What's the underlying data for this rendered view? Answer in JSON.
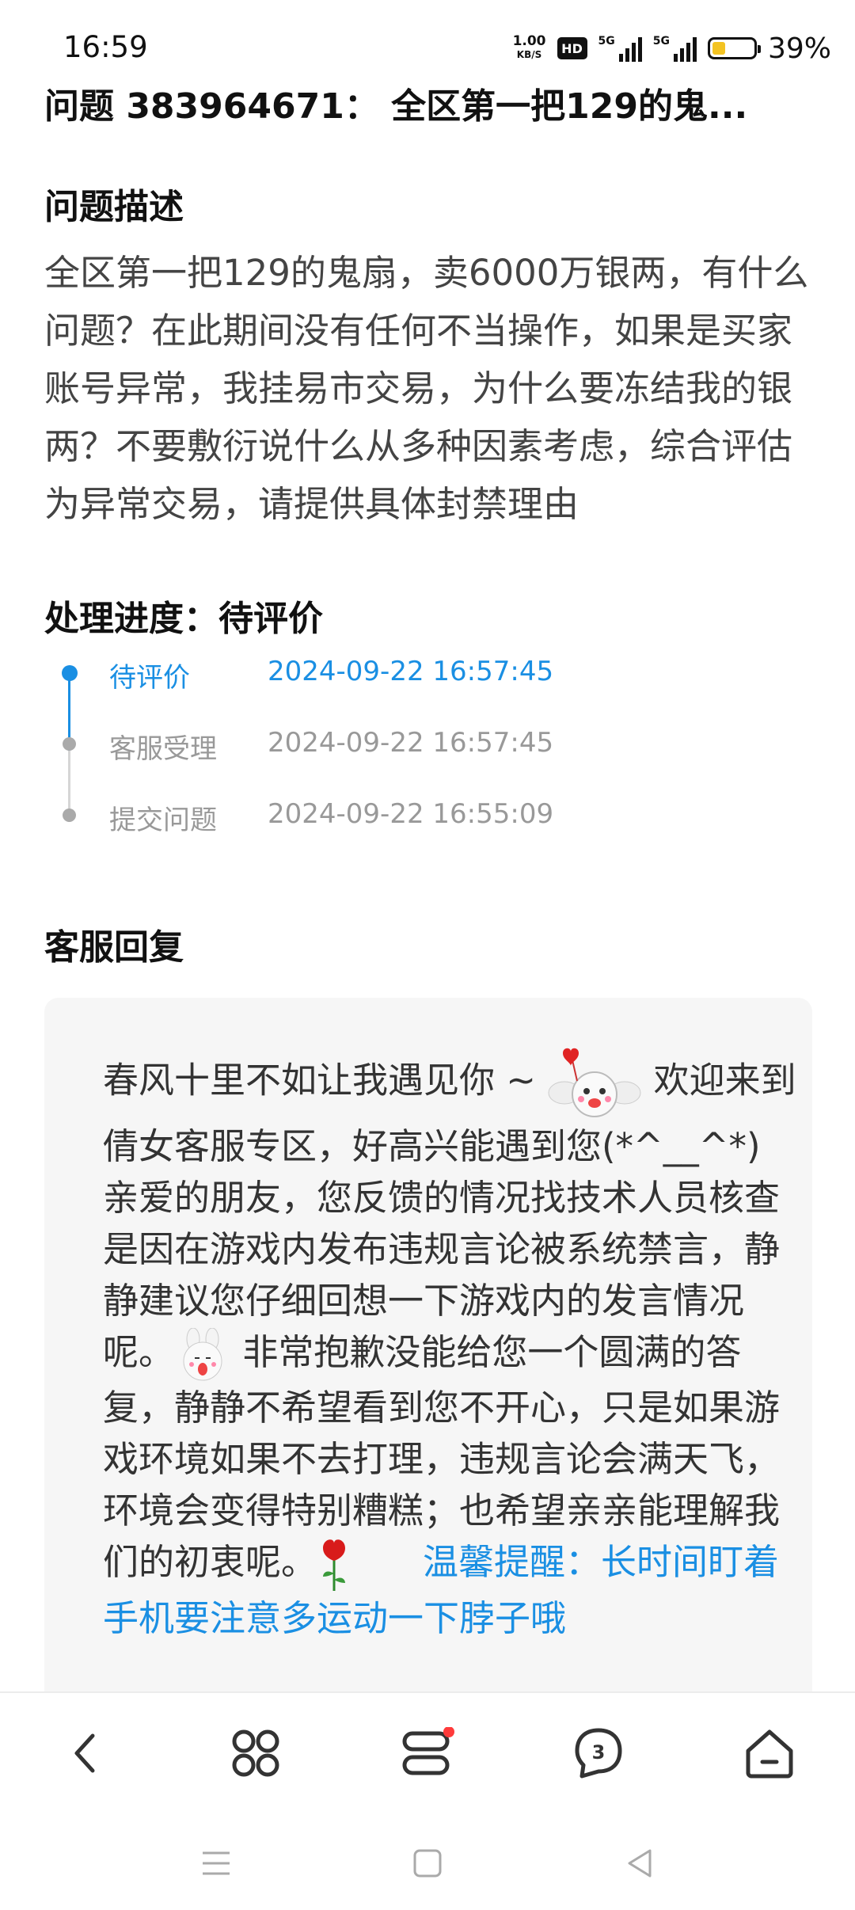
{
  "status_bar": {
    "time": "16:59",
    "net_speed_value": "1.00",
    "net_speed_unit": "KB/S",
    "hd_badge": "HD",
    "sim1": "5G",
    "sim2": "5G",
    "battery_level": 0.39,
    "battery_percent": "39%",
    "battery_color": "#f3c322"
  },
  "header": {
    "title": "问题 383964671：  全区第一把129的鬼..."
  },
  "description": {
    "heading": "问题描述",
    "text": "全区第一把129的鬼扇，卖6000万银两，有什么问题？在此期间没有任何不当操作，如果是买家账号异常，我挂易市交易，为什么要冻结我的银两？不要敷衍说什么从多种因素考虑，综合评估为异常交易，请提供具体封禁理由"
  },
  "progress": {
    "heading": "处理进度：待评价",
    "accent_color": "#1a8fe3",
    "steps": [
      {
        "label": "待评价",
        "time": "2024-09-22 16:57:45",
        "active": true
      },
      {
        "label": "客服受理",
        "time": "2024-09-22 16:57:45",
        "active": false
      },
      {
        "label": "提交问题",
        "time": "2024-09-22 16:55:09",
        "active": false
      }
    ]
  },
  "reply": {
    "heading": "客服回复",
    "part1": "春风十里不如让我遇见你 ~ ",
    "emoji1": "angel-heart-emoji",
    "part2": " 欢迎来到倩女客服专区，好高兴能遇到您(*^__^*)　　亲爱的朋友，您反馈的情况找技术人员核查是因在游戏内发布违规言论被系统禁言，静静建议您仔细回想一下游戏内的发言情况呢。",
    "emoji2": "crying-bunny-emoji",
    "part3": " 非常抱歉没能给您一个圆满的答复，静静不希望看到您不开心，只是如果游戏环境如果不去打理，违规言论会满天飞，环境会变得特别糟糕；也希望亲亲能理解我们的初衷呢。",
    "emoji3": "rose-emoji",
    "tip": "　　温馨提醒：长时间盯着手机要注意多运动一下脖子哦"
  },
  "bottom_nav": {
    "items": [
      {
        "name": "back",
        "icon": "chevron-left-icon"
      },
      {
        "name": "apps",
        "icon": "clover-icon"
      },
      {
        "name": "tasks",
        "icon": "stack-icon",
        "badge": true
      },
      {
        "name": "messages",
        "icon": "chat-bubble-icon",
        "count": "3"
      },
      {
        "name": "home",
        "icon": "home-icon"
      }
    ],
    "badge_color": "#ff3b3b"
  },
  "system_nav": {
    "items": [
      "menu-icon",
      "square-icon",
      "back-triangle-icon"
    ]
  }
}
